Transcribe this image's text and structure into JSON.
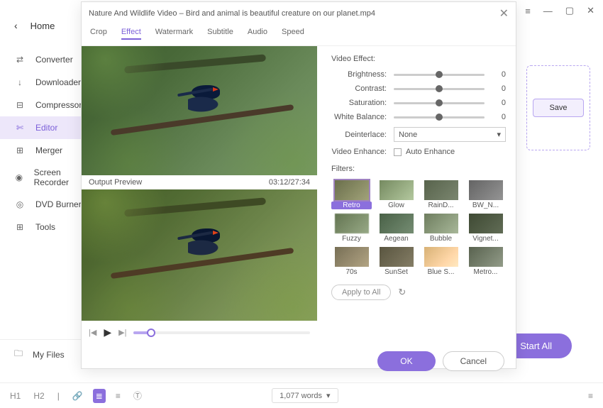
{
  "titlebar": {
    "menu": "≡",
    "min": "—",
    "max": "▢",
    "close": "✕"
  },
  "sidebar": {
    "home": "Home",
    "items": [
      {
        "icon": "⇄",
        "label": "Converter"
      },
      {
        "icon": "↓",
        "label": "Downloader"
      },
      {
        "icon": "⊟",
        "label": "Compressor"
      },
      {
        "icon": "✄",
        "label": "Editor"
      },
      {
        "icon": "⊞",
        "label": "Merger"
      },
      {
        "icon": "◉",
        "label": "Screen Recorder"
      },
      {
        "icon": "◎",
        "label": "DVD Burner"
      },
      {
        "icon": "⊞",
        "label": "Tools"
      }
    ],
    "myfiles": "My Files"
  },
  "right": {
    "save": "Save",
    "start_all": "Start All"
  },
  "modal": {
    "title": "Nature And Wildlife Video – Bird and animal is beautiful creature on our planet.mp4",
    "tabs": [
      "Crop",
      "Effect",
      "Watermark",
      "Subtitle",
      "Audio",
      "Speed"
    ],
    "active_tab": 1,
    "output_preview": "Output Preview",
    "time": "03:12/27:34",
    "video_effect": "Video Effect:",
    "sliders": [
      {
        "label": "Brightness:",
        "val": "0"
      },
      {
        "label": "Contrast:",
        "val": "0"
      },
      {
        "label": "Saturation:",
        "val": "0"
      },
      {
        "label": "White Balance:",
        "val": "0"
      }
    ],
    "deinterlace": {
      "label": "Deinterlace:",
      "value": "None"
    },
    "enhance": {
      "label": "Video Enhance:",
      "value": "Auto Enhance"
    },
    "filters_label": "Filters:",
    "filters": [
      {
        "name": "Retro",
        "cls": "retro"
      },
      {
        "name": "Glow",
        "cls": "glow"
      },
      {
        "name": "RainD...",
        "cls": "rain"
      },
      {
        "name": "BW_N...",
        "cls": "bw"
      },
      {
        "name": "Fuzzy",
        "cls": "fuzzy"
      },
      {
        "name": "Aegean",
        "cls": "aegean"
      },
      {
        "name": "Bubble",
        "cls": "bubble"
      },
      {
        "name": "Vignet...",
        "cls": "vign"
      },
      {
        "name": "70s",
        "cls": "s70"
      },
      {
        "name": "SunSet",
        "cls": "sunset"
      },
      {
        "name": "Blue S...",
        "cls": "bluesky"
      },
      {
        "name": "Metro...",
        "cls": "metro"
      }
    ],
    "apply_all": "Apply to All",
    "ok": "OK",
    "cancel": "Cancel"
  },
  "bottom": {
    "h1": "H1",
    "h2": "H2",
    "words": "1,077 words"
  }
}
